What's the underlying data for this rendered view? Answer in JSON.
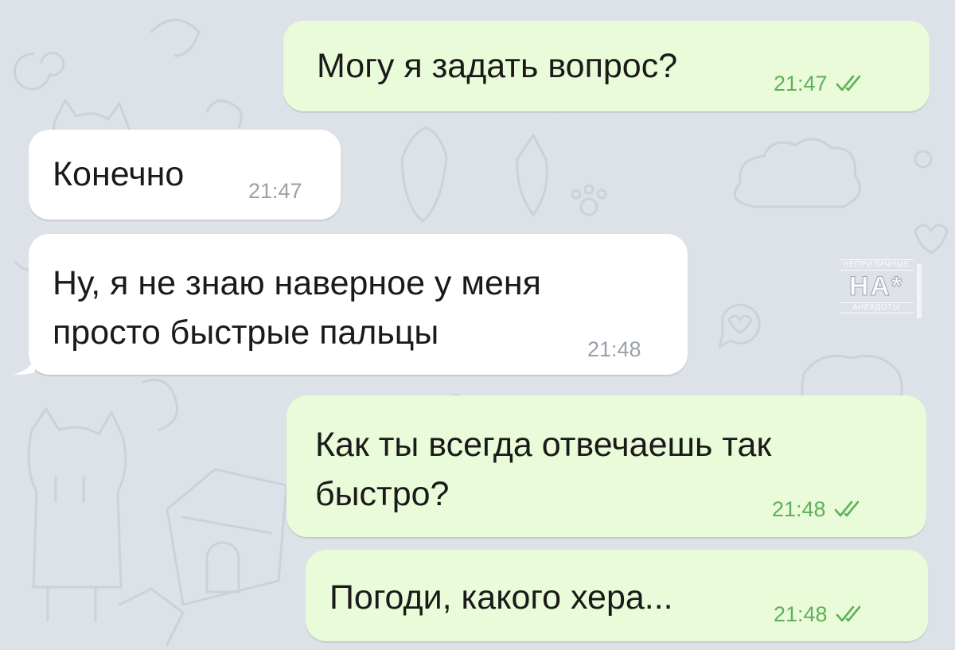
{
  "chat": {
    "messages": [
      {
        "direction": "out",
        "text_lines": [
          "Могу я задать вопрос?"
        ],
        "time": "21:47",
        "read": true
      },
      {
        "direction": "in",
        "text_lines": [
          "Конечно"
        ],
        "time": "21:47"
      },
      {
        "direction": "in",
        "text_lines": [
          "Ну, я не знаю наверное у меня",
          "просто быстрые пальцы"
        ],
        "time": "21:48"
      },
      {
        "direction": "out",
        "text_lines": [
          "Как ты всегда отвечаешь так",
          "быстро?"
        ],
        "time": "21:48",
        "read": true
      },
      {
        "direction": "out",
        "text_lines": [
          "Погоди, какого хера..."
        ],
        "time": "21:48",
        "read": true
      }
    ]
  },
  "watermark": {
    "top": "НЕПРИЛИЧНЫЕ",
    "main": "НА*",
    "bottom": "АНЕКДОТЫ"
  },
  "colors": {
    "background": "#dde1e8",
    "outgoing_bubble": "#e9fbd8",
    "incoming_bubble": "#ffffff",
    "outgoing_meta": "#5fb05a",
    "incoming_meta": "#9aa1a8"
  },
  "icons": {
    "read_status": "double-check-icon"
  }
}
